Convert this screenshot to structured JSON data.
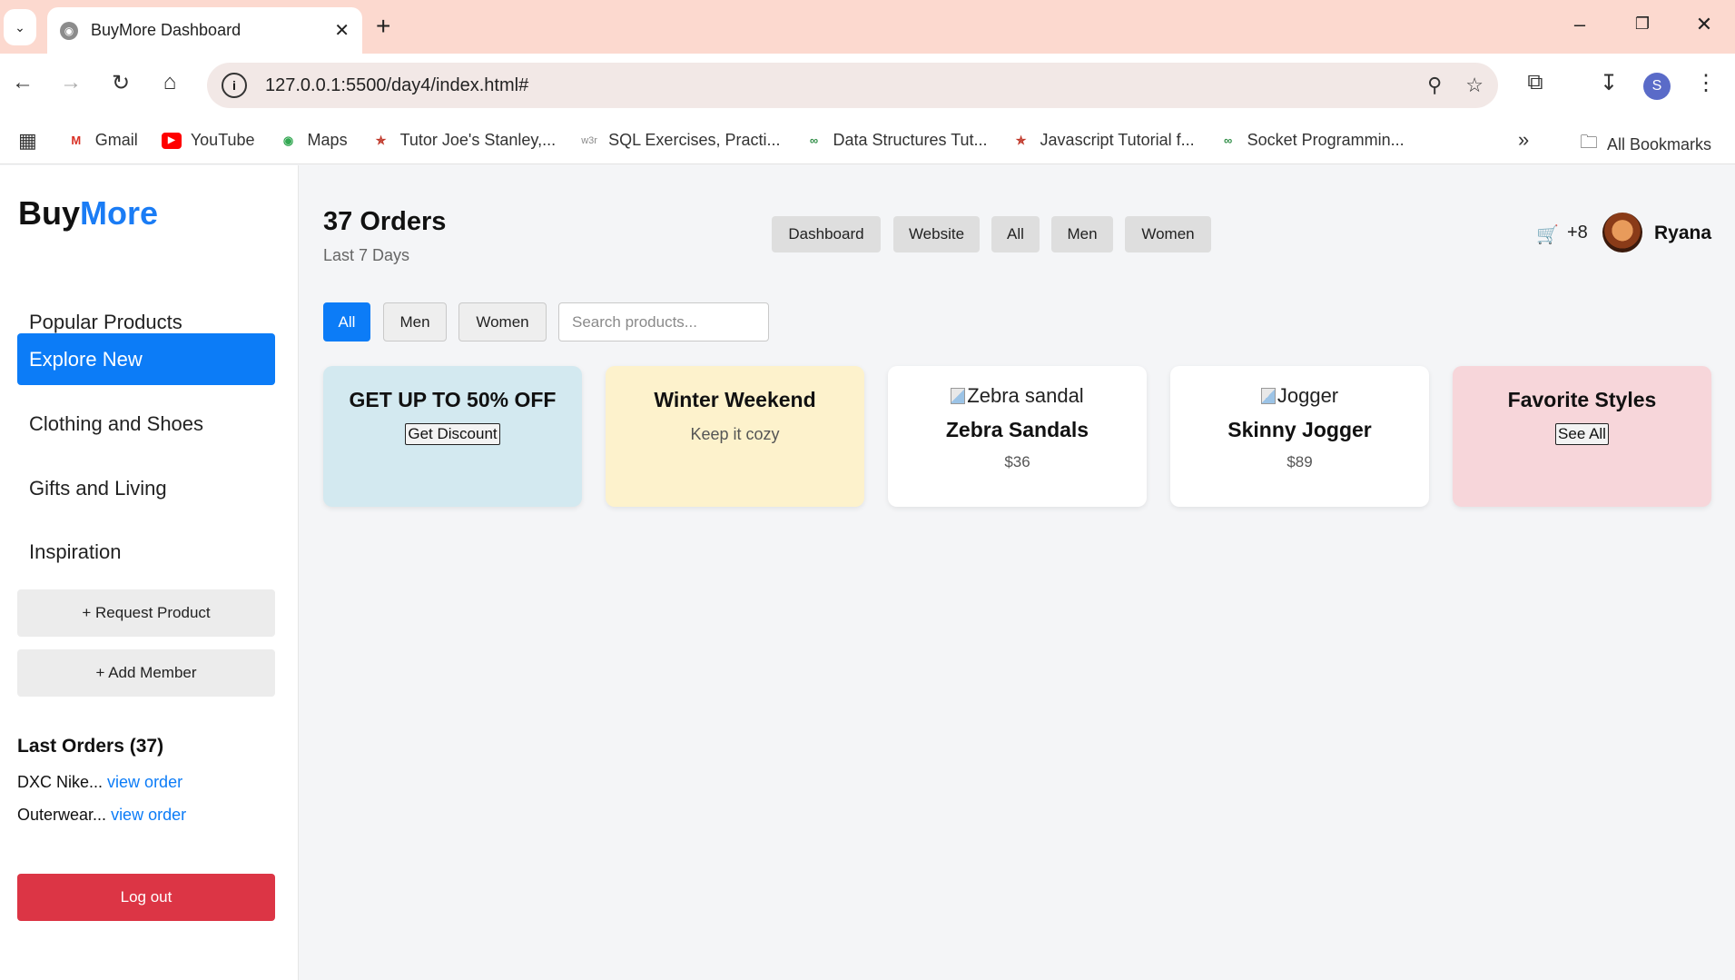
{
  "browser": {
    "tab_title": "BuyMore Dashboard",
    "url": "127.0.0.1:5500/day4/index.html#",
    "profile_initial": "S",
    "bookmarks": [
      {
        "label": "Gmail",
        "icon": "gmail-icon"
      },
      {
        "label": "YouTube",
        "icon": "youtube-icon"
      },
      {
        "label": "Maps",
        "icon": "maps-icon"
      },
      {
        "label": "Tutor Joe's Stanley,...",
        "icon": "tutorjoes-icon"
      },
      {
        "label": "SQL Exercises, Practi...",
        "icon": "w3r-icon"
      },
      {
        "label": "Data Structures Tut...",
        "icon": "gfg-icon"
      },
      {
        "label": "Javascript Tutorial f...",
        "icon": "tutorjoes-icon"
      },
      {
        "label": "Socket Programmin...",
        "icon": "gfg-icon"
      }
    ],
    "all_bookmarks": "All Bookmarks"
  },
  "sidebar": {
    "brand_part1": "Buy",
    "brand_part2": "More",
    "items": [
      {
        "label": "Popular Products"
      },
      {
        "label": "Explore New"
      },
      {
        "label": "Clothing and Shoes"
      },
      {
        "label": "Gifts and Living"
      },
      {
        "label": "Inspiration"
      }
    ],
    "request_product": "+ Request Product",
    "add_member": "+ Add Member",
    "last_orders_title": "Last Orders (37)",
    "orders": [
      {
        "name": "DXC Nike...",
        "link": "view order"
      },
      {
        "name": "Outerwear...",
        "link": "view order"
      }
    ],
    "logout": "Log out"
  },
  "header": {
    "title": "37 Orders",
    "subtitle": "Last 7 Days",
    "nav": [
      "Dashboard",
      "Website",
      "All",
      "Men",
      "Women"
    ],
    "cart_count": "+8",
    "user_name": "Ryana"
  },
  "filters": {
    "buttons": [
      "All",
      "Men",
      "Women"
    ],
    "active": "All",
    "search_placeholder": "Search products..."
  },
  "cards": {
    "promo": {
      "title": "GET UP TO 50% OFF",
      "button": "Get Discount",
      "color": "#d3e9f0"
    },
    "winter": {
      "title": "Winter Weekend",
      "subtitle": "Keep it cozy",
      "color": "#fdf2cc"
    },
    "product1": {
      "alt": "Zebra sandal",
      "name": "Zebra Sandals",
      "price": "$36"
    },
    "product2": {
      "alt": "Jogger",
      "name": "Skinny Jogger",
      "price": "$89"
    },
    "favorite": {
      "title": "Favorite Styles",
      "button": "See All",
      "color": "#f7d6da"
    }
  },
  "colors": {
    "accent": "#0c7cf7",
    "danger": "#dc3545",
    "tabbar": "#fcd9cf"
  }
}
